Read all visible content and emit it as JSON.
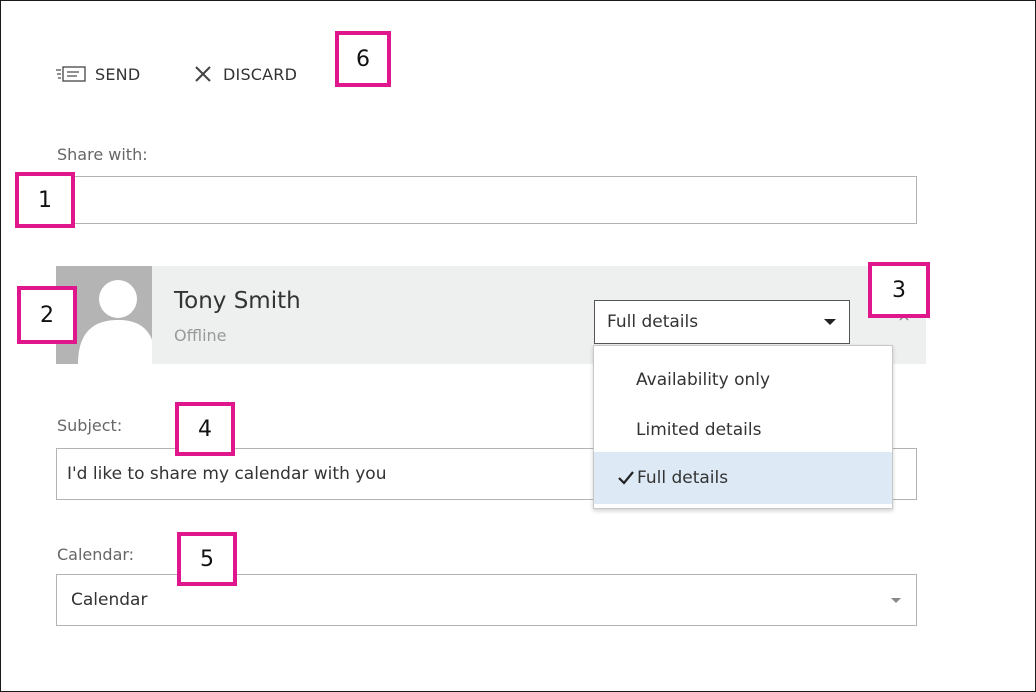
{
  "toolbar": {
    "send_label": "SEND",
    "discard_label": "DISCARD",
    "send_icon": "send-icon",
    "discard_icon": "close-icon"
  },
  "share_with": {
    "label": "Share with:",
    "value": ""
  },
  "recipient": {
    "name": "Tony Smith",
    "status": "Offline",
    "permission": "Full details",
    "remove_icon": "close-icon"
  },
  "permission_menu": {
    "options": [
      {
        "label": "Availability only",
        "selected": false
      },
      {
        "label": "Limited details",
        "selected": false
      },
      {
        "label": "Full details",
        "selected": true
      }
    ]
  },
  "subject": {
    "label": "Subject:",
    "value": "I'd like to share my calendar with you"
  },
  "calendar": {
    "label": "Calendar:",
    "value": "Calendar"
  },
  "callouts": [
    "1",
    "2",
    "3",
    "4",
    "5",
    "6"
  ],
  "colors": {
    "callout_border": "#e0168c",
    "selected_item_bg": "#dde9f5",
    "card_bg": "#eef0f0"
  }
}
